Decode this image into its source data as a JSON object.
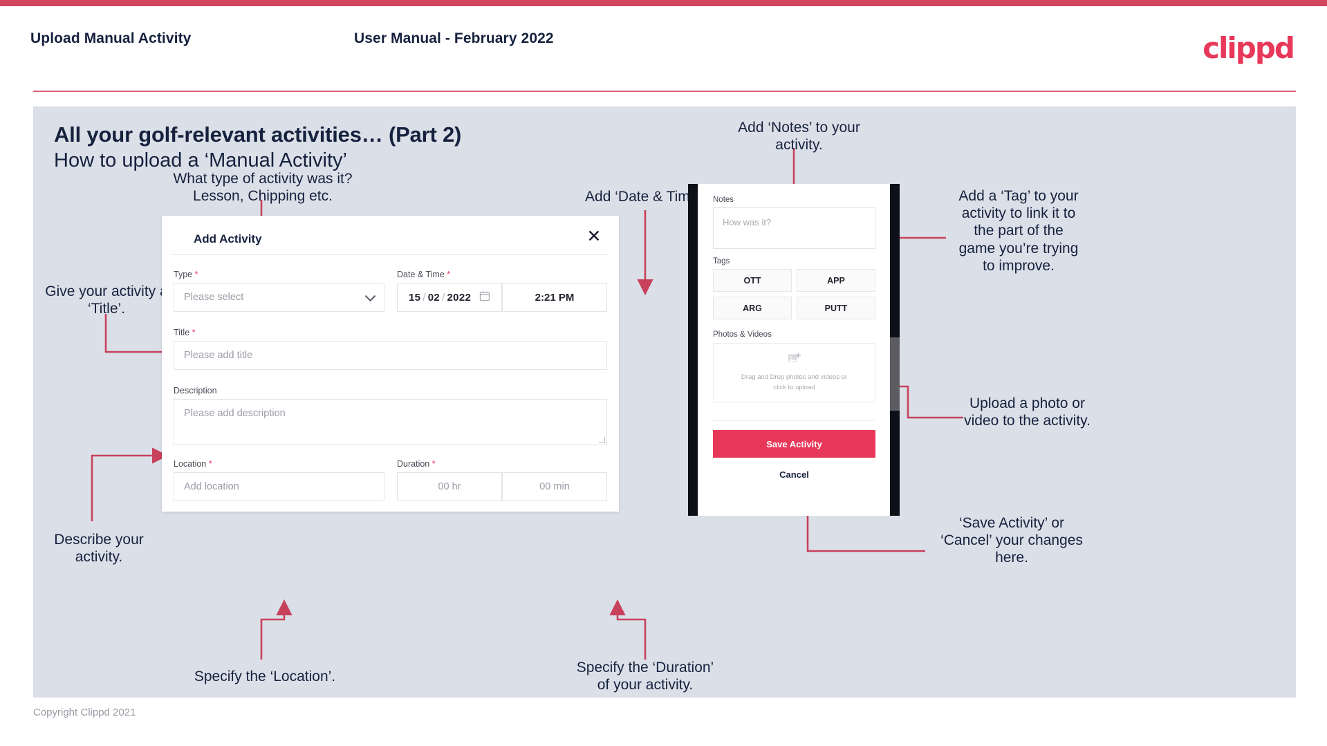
{
  "header": {
    "left_title": "Upload Manual Activity",
    "center_title": "User Manual - February 2022",
    "logo": "clippd"
  },
  "slide": {
    "title": "All your golf-relevant activities… (Part 2)",
    "subtitle": "How to upload a ‘Manual Activity’"
  },
  "annotations": {
    "type": "What type of activity was it?\nLesson, Chipping etc.",
    "datetime": "Add ‘Date & Time’.",
    "title": "Give your activity a\n‘Title’.",
    "description": "Describe your\nactivity.",
    "location": "Specify the ‘Location’.",
    "duration": "Specify the ‘Duration’\nof your activity.",
    "notes": "Add ‘Notes’ to your\nactivity.",
    "tags": "Add a ‘Tag’ to your\nactivity to link it to\nthe part of the\ngame you’re trying\nto improve.",
    "upload": "Upload a photo or\nvideo to the activity.",
    "save": "‘Save Activity’ or\n‘Cancel’ your changes\nhere."
  },
  "dialog": {
    "title": "Add Activity",
    "close_icon": "close-icon",
    "fields": {
      "type": {
        "label": "Type",
        "required": "*",
        "placeholder": "Please select"
      },
      "datetime": {
        "label": "Date & Time",
        "required": "*",
        "day": "15",
        "month": "02",
        "year": "2022",
        "time": "2:21 PM"
      },
      "title": {
        "label": "Title",
        "required": "*",
        "placeholder": "Please add title"
      },
      "description": {
        "label": "Description",
        "required": "",
        "placeholder": "Please add description"
      },
      "location": {
        "label": "Location",
        "required": "*",
        "placeholder": "Add location"
      },
      "duration": {
        "label": "Duration",
        "required": "*",
        "hours": "00 hr",
        "minutes": "00 min"
      }
    }
  },
  "phone": {
    "notes": {
      "label": "Notes",
      "placeholder": "How was it?"
    },
    "tags": {
      "label": "Tags",
      "items": [
        "OTT",
        "APP",
        "ARG",
        "PUTT"
      ]
    },
    "photos": {
      "label": "Photos & Videos",
      "dropzone_line1": "Drag and Drop photos and videos or",
      "dropzone_line2": "click to upload",
      "icon": "add-image-icon"
    },
    "save_label": "Save Activity",
    "cancel_label": "Cancel"
  },
  "footer": "Copyright Clippd 2021",
  "colors": {
    "brand_pink": "#e8385a",
    "topbar": "#d2455e",
    "slide_bg": "#dbe0e8",
    "text_dark": "#16213e",
    "arrow": "#c8415c"
  }
}
